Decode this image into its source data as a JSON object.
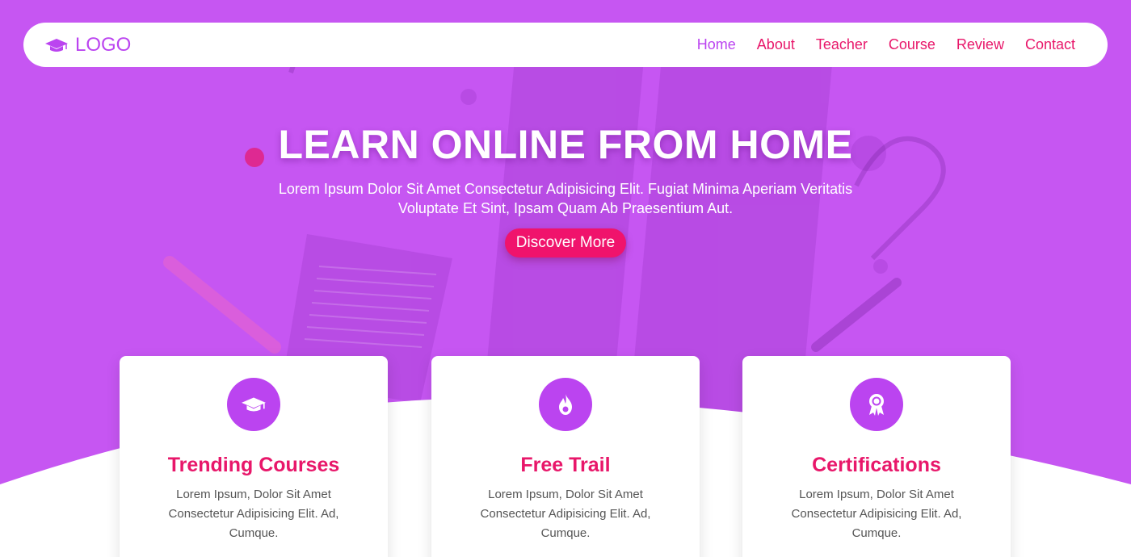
{
  "nav": {
    "logo_text": "LOGO",
    "links": [
      {
        "label": "Home"
      },
      {
        "label": "About"
      },
      {
        "label": "Teacher"
      },
      {
        "label": "Course"
      },
      {
        "label": "Review"
      },
      {
        "label": "Contact"
      }
    ]
  },
  "hero": {
    "title": "LEARN ONLINE FROM HOME",
    "subtitle": "Lorem Ipsum Dolor Sit Amet Consectetur Adipisicing Elit. Fugiat Minima Aperiam Veritatis Voluptate Et Sint, Ipsam Quam Ab Praesentium Aut.",
    "button_label": "Discover More"
  },
  "features": [
    {
      "icon": "graduation-cap-icon",
      "title": "Trending Courses",
      "text": "Lorem Ipsum, Dolor Sit Amet Consectetur Adipisicing Elit. Ad, Cumque."
    },
    {
      "icon": "fire-icon",
      "title": "Free Trail",
      "text": "Lorem Ipsum, Dolor Sit Amet Consectetur Adipisicing Elit. Ad, Cumque."
    },
    {
      "icon": "award-icon",
      "title": "Certifications",
      "text": "Lorem Ipsum, Dolor Sit Amet Consectetur Adipisicing Elit. Ad, Cumque."
    }
  ],
  "colors": {
    "primary_purple": "#bb44f0",
    "accent_pink": "#e8176a",
    "button_pink": "#f0136c",
    "hero_bg": "#c656f2"
  }
}
